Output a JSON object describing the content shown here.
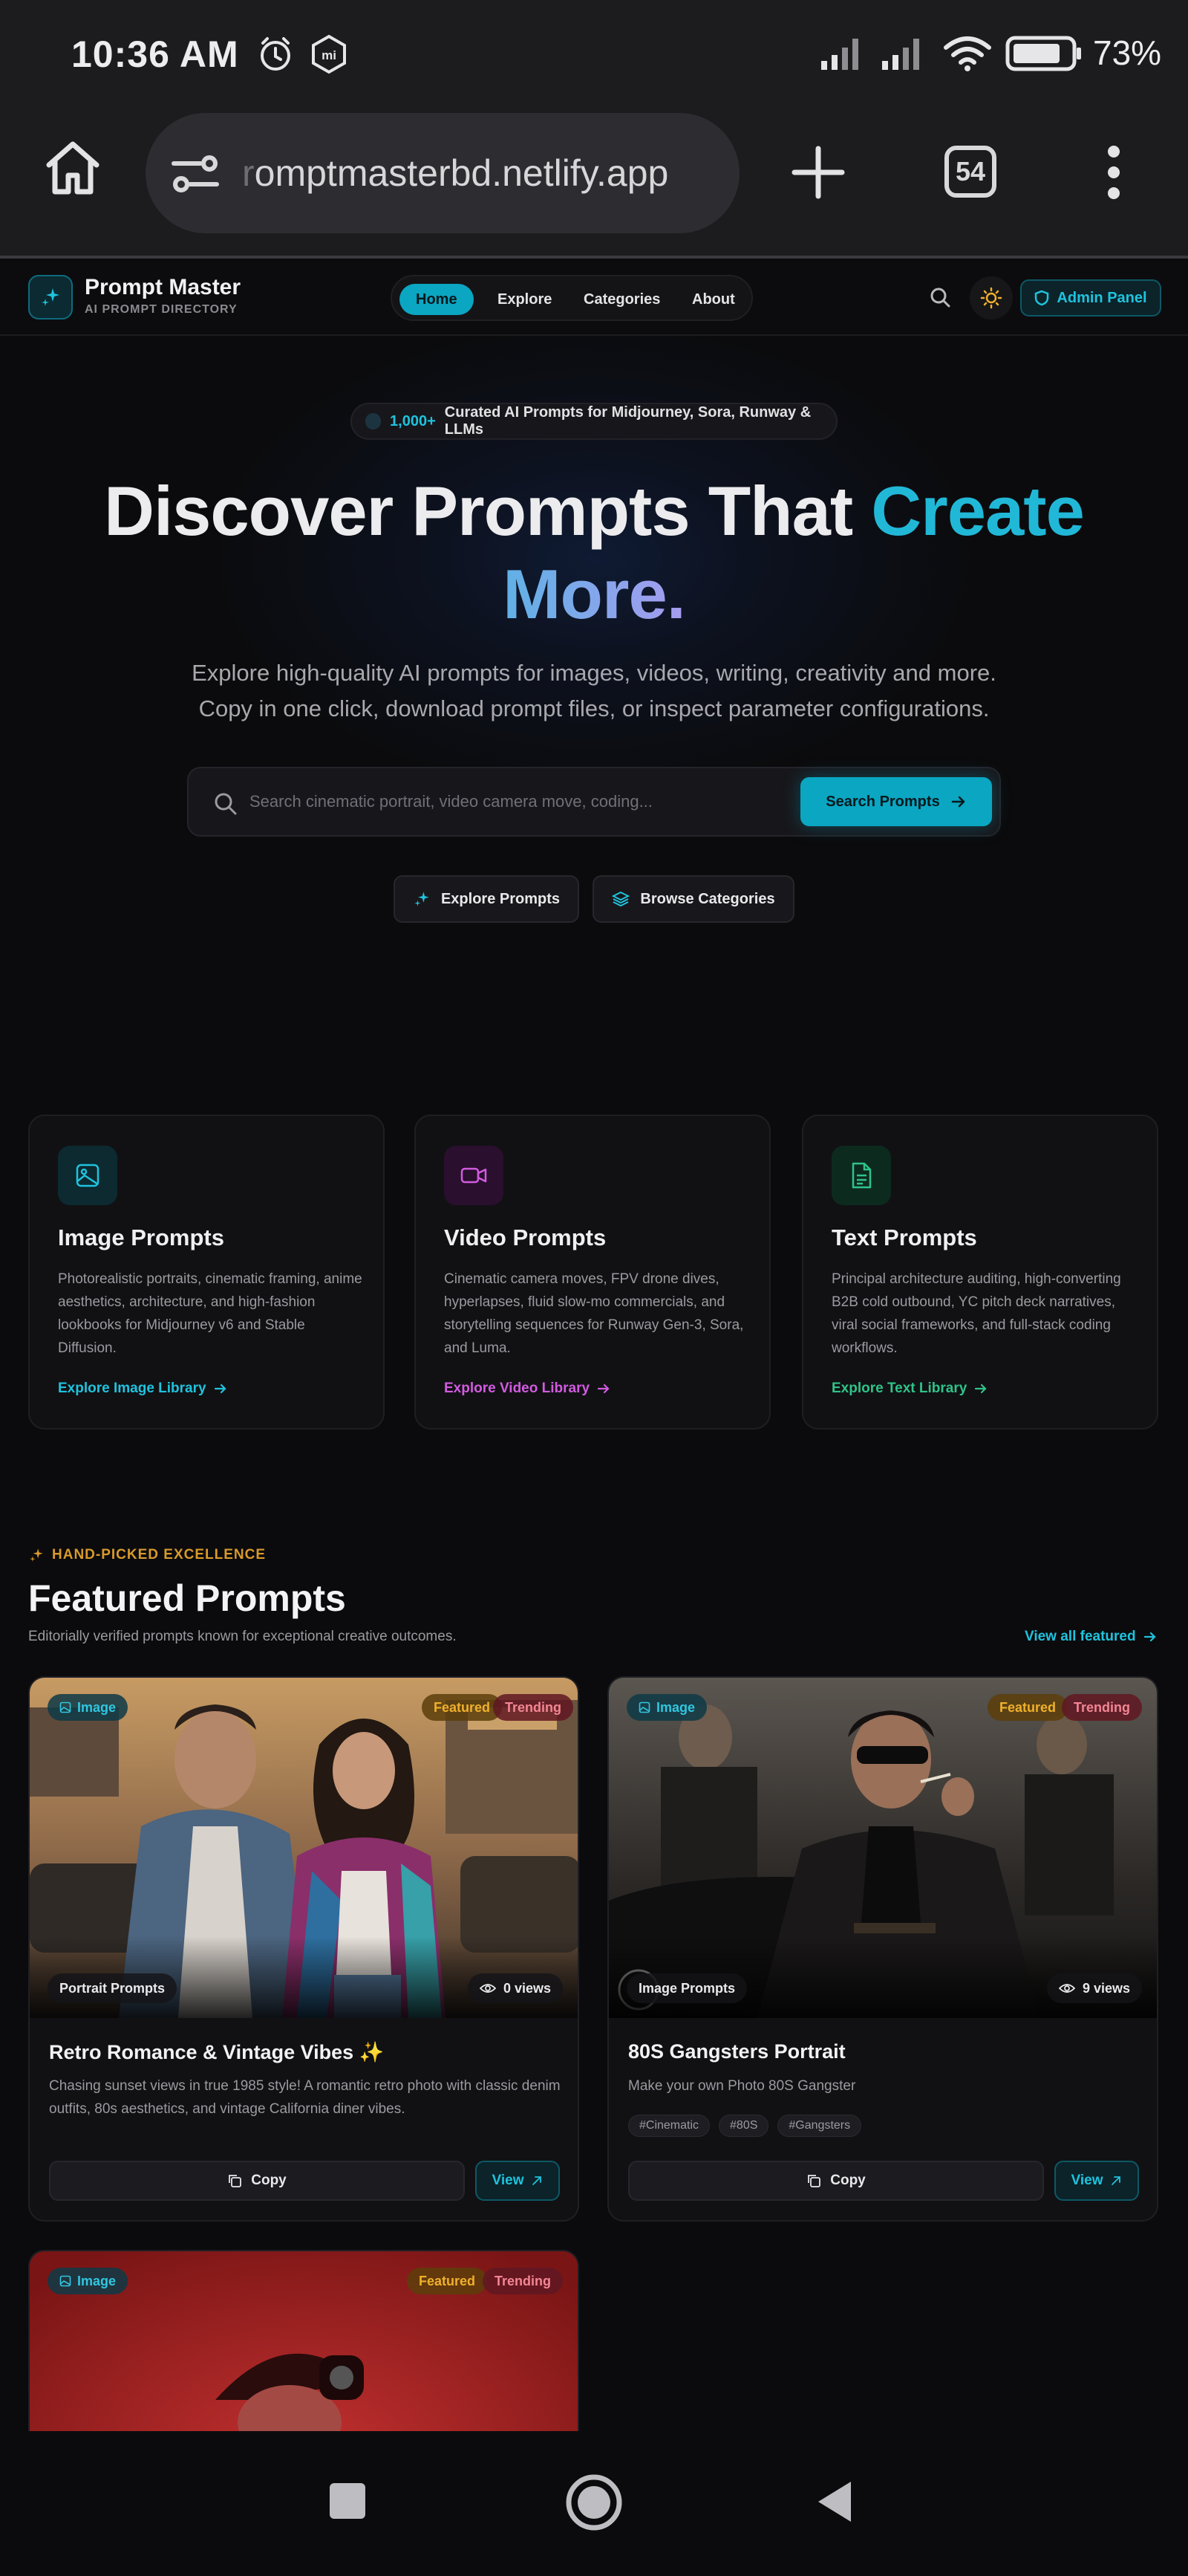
{
  "status_bar": {
    "time": "10:36 AM",
    "battery": "73%"
  },
  "browser": {
    "url_faded": "r",
    "url_rest": "omptmasterbd.netlify.app",
    "tab_count": "54"
  },
  "site": {
    "brand": "Prompt Master",
    "brand_sub": "AI PROMPT DIRECTORY",
    "nav": [
      "Home",
      "Explore",
      "Categories",
      "About"
    ],
    "admin": "Admin Panel"
  },
  "hero": {
    "badge_count": "1,000+",
    "badge_text": "Curated AI Prompts for Midjourney, Sora, Runway & LLMs",
    "title_plain": "Discover Prompts That",
    "title_accent1": "Create",
    "title_accent2": "More.",
    "subtitle_line1": "Explore high-quality AI prompts for images, videos, writing, creativity and more.",
    "subtitle_line2": "Copy in one click, download prompt files, or inspect parameter configurations.",
    "search_placeholder": "Search cinematic portrait, video camera move, coding...",
    "search_button": "Search Prompts",
    "explore_button": "Explore Prompts",
    "browse_button": "Browse Categories"
  },
  "categories": [
    {
      "title": "Image Prompts",
      "desc": "Photorealistic portraits, cinematic framing, anime aesthetics, architecture, and high-fashion lookbooks for Midjourney v6 and Stable Diffusion.",
      "link": "Explore Image Library",
      "color": "#1fc3de"
    },
    {
      "title": "Video Prompts",
      "desc": "Cinematic camera moves, FPV drone dives, hyperlapses, fluid slow-mo commercials, and storytelling sequences for Runway Gen-3, Sora, and Luma.",
      "link": "Explore Video Library",
      "color": "#d25be0"
    },
    {
      "title": "Text Prompts",
      "desc": "Principal architecture auditing, high-converting B2B cold outbound, YC pitch deck narratives, viral social frameworks, and full-stack coding workflows.",
      "link": "Explore Text Library",
      "color": "#2fc389"
    }
  ],
  "featured": {
    "eyebrow": "HAND-PICKED EXCELLENCE",
    "title": "Featured Prompts",
    "subtitle": "Editorially verified prompts known for exceptional creative outcomes.",
    "view_all": "View all featured",
    "cards": [
      {
        "type": "Image",
        "featured": "Featured",
        "trending": "Trending",
        "category": "Portrait Prompts",
        "views": "0 views",
        "title": "Retro Romance & Vintage Vibes ✨",
        "desc": "Chasing sunset views in true 1985 style! A romantic retro photo with classic denim outfits, 80s aesthetics, and vintage California diner vibes.",
        "copy": "Copy",
        "view": "View"
      },
      {
        "type": "Image",
        "featured": "Featured",
        "trending": "Trending",
        "category": "Image Prompts",
        "views": "9 views",
        "title": "80S Gangsters Portrait",
        "desc": "Make your own Photo 80S Gangster",
        "tags": [
          "#Cinematic",
          "#80S",
          "#Gangsters"
        ],
        "copy": "Copy",
        "view": "View"
      },
      {
        "type": "Image",
        "featured": "Featured",
        "trending": "Trending"
      }
    ]
  }
}
